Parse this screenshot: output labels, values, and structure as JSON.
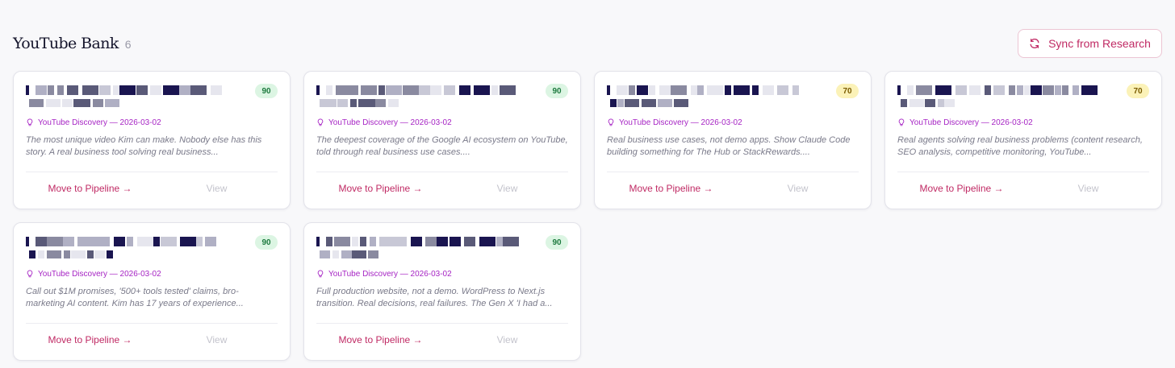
{
  "header": {
    "title": "YouTube Bank",
    "count": "6",
    "sync_label": "Sync from Research"
  },
  "colors": {
    "accent": "#c02a64",
    "source": "#a624c4",
    "score_high_bg": "#dcf5e3",
    "score_mid_bg": "#fbf2b8"
  },
  "cards": [
    {
      "score": "90",
      "source": "YouTube Discovery — 2026-03-02",
      "desc": "The most unique video Kim can make. Nobody else has this story. A real business tool solving real business...",
      "move_label": "Move to Pipeline →",
      "view_label": "View"
    },
    {
      "score": "90",
      "source": "YouTube Discovery — 2026-03-02",
      "desc": "The deepest coverage of the Google AI ecosystem on YouTube, told through real business use cases....",
      "move_label": "Move to Pipeline →",
      "view_label": "View"
    },
    {
      "score": "70",
      "source": "YouTube Discovery — 2026-03-02",
      "desc": "Real business use cases, not demo apps. Show Claude Code building something for The Hub or StackRewards....",
      "move_label": "Move to Pipeline →",
      "view_label": "View"
    },
    {
      "score": "70",
      "source": "YouTube Discovery — 2026-03-02",
      "desc": "Real agents solving real business problems (content research, SEO analysis, competitive monitoring, YouTube...",
      "move_label": "Move to Pipeline →",
      "view_label": "View"
    },
    {
      "score": "90",
      "source": "YouTube Discovery — 2026-03-02",
      "desc": "Call out $1M promises, '500+ tools tested' claims, bro-marketing AI content. Kim has 17 years of experience...",
      "move_label": "Move to Pipeline →",
      "view_label": "View"
    },
    {
      "score": "90",
      "source": "YouTube Discovery — 2026-03-02",
      "desc": "Full production website, not a demo. WordPress to Next.js transition. Real decisions, real failures. The Gen X 'I had a...",
      "move_label": "Move to Pipeline →",
      "view_label": "View"
    }
  ]
}
